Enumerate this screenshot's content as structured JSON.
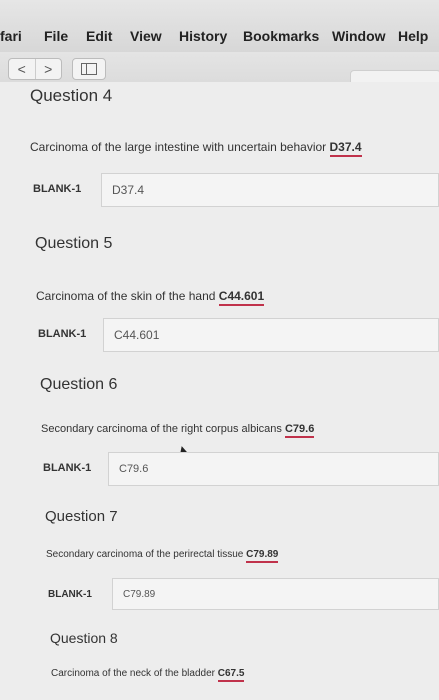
{
  "menubar": {
    "app": "fari",
    "items": [
      "File",
      "Edit",
      "View",
      "History",
      "Bookmarks",
      "Window",
      "Help"
    ]
  },
  "toolbar": {
    "back": "<",
    "forward": ">"
  },
  "questions": [
    {
      "title": "Question 4",
      "text": "Carcinoma of the large intestine with uncertain behavior",
      "code": "D37.4",
      "blank_label": "BLANK-1",
      "answer": "D37.4"
    },
    {
      "title": "Question 5",
      "text": "Carcinoma of the skin of the hand",
      "code": "C44.601",
      "blank_label": "BLANK-1",
      "answer": "C44.601"
    },
    {
      "title": "Question 6",
      "text": "Secondary carcinoma of the right corpus albicans",
      "code": "C79.6",
      "blank_label": "BLANK-1",
      "answer": "C79.6"
    },
    {
      "title": "Question 7",
      "text": "Secondary carcinoma of the perirectal tissue",
      "code": "C79.89",
      "blank_label": "BLANK-1",
      "answer": "C79.89"
    },
    {
      "title": "Question 8",
      "text": "Carcinoma of the neck of the bladder",
      "code": "C67.5"
    }
  ]
}
